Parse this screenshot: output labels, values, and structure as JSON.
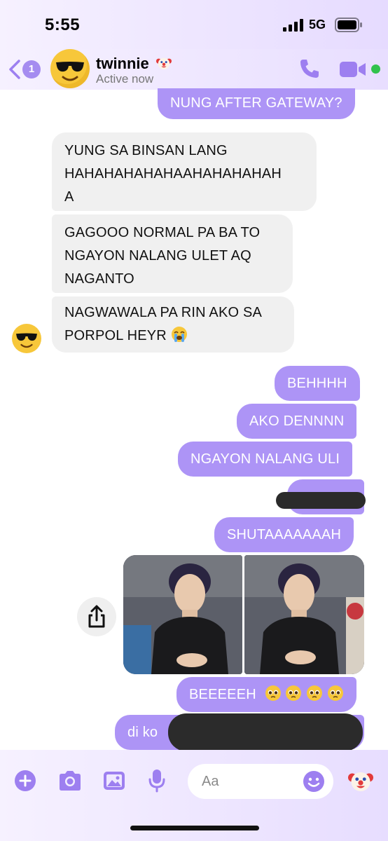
{
  "status_bar": {
    "time": "5:55",
    "network": "5G"
  },
  "header": {
    "unread_count": "1",
    "contact_name": "twinnie",
    "active_status": "Active now",
    "avatar_emoji": "smiling-face-with-sunglasses",
    "name_emoji": "clown-face"
  },
  "messages": {
    "m0": {
      "text": "NUNG AFTER GATEWAY?"
    },
    "m1": {
      "lines": [
        "YUNG SA BINSAN LANG",
        "HAHAHAHAHAHAAHAHAHAHAH",
        "A"
      ]
    },
    "m2": {
      "lines": [
        "GAGOOO NORMAL PA BA TO",
        "NGAYON NALANG ULET AQ",
        "NAGANTO"
      ]
    },
    "m3": {
      "lines": [
        "NAGWAWALA PA RIN AKO SA",
        "PORPOL HEYR"
      ],
      "emoji": "loudly-crying-face"
    },
    "m4": {
      "text": "BEHHHH"
    },
    "m5": {
      "text": "AKO DENNNN"
    },
    "m6": {
      "text": "NGAYON NALANG ULI"
    },
    "m7": {
      "text": "SHUTAAAAAAAH"
    },
    "m8": {
      "text": "BEEEEEH",
      "emoji": "pleading-face"
    },
    "m9": {
      "text": "di ko"
    }
  },
  "composer": {
    "placeholder": "Aa",
    "quick_reaction": "clown-face"
  },
  "colors": {
    "outgoing": "#ad94f6",
    "incoming": "#f0f0f0",
    "accent": "#9d7ff0",
    "online": "#31c24d"
  }
}
